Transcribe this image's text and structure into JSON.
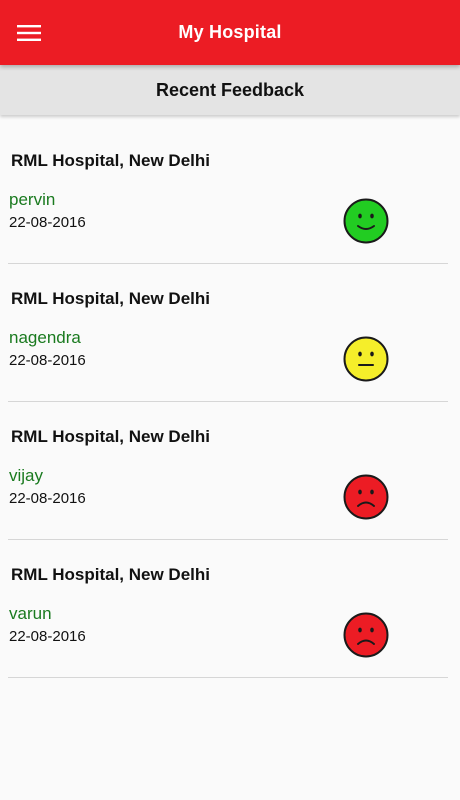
{
  "appbar": {
    "title": "My Hospital",
    "menu_icon": "hamburger-menu-icon",
    "background_color": "#ec1c24"
  },
  "subheader": {
    "title": "Recent Feedback"
  },
  "feedback": [
    {
      "hospital": "RML Hospital, New Delhi",
      "name": "pervin",
      "date": "22-08-2016",
      "rating_icon": "happy-face-icon",
      "rating_color": "#22cc22",
      "rating": "happy"
    },
    {
      "hospital": "RML Hospital, New Delhi",
      "name": "nagendra",
      "date": "22-08-2016",
      "rating_icon": "neutral-face-icon",
      "rating_color": "#f5ee2a",
      "rating": "neutral"
    },
    {
      "hospital": "RML Hospital, New Delhi",
      "name": "vijay",
      "date": "22-08-2016",
      "rating_icon": "sad-face-icon",
      "rating_color": "#ec1c24",
      "rating": "sad"
    },
    {
      "hospital": "RML Hospital, New Delhi",
      "name": "varun",
      "date": "22-08-2016",
      "rating_icon": "sad-face-icon",
      "rating_color": "#ec1c24",
      "rating": "sad"
    }
  ]
}
